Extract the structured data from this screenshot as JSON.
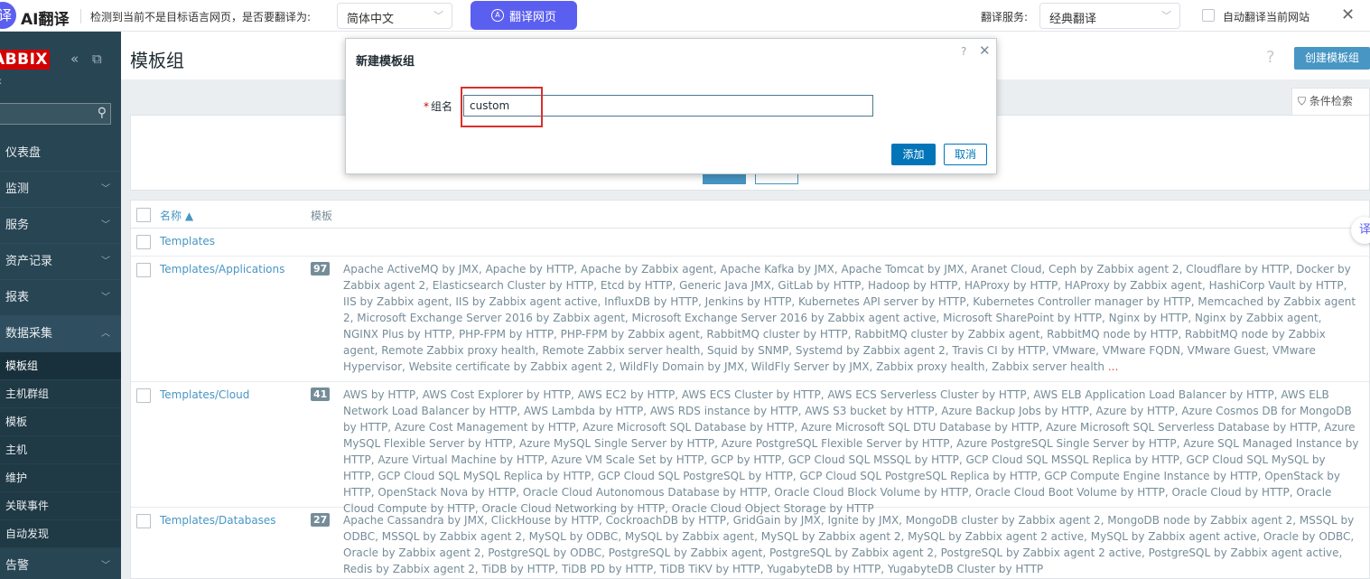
{
  "translate_bar": {
    "logo_glyph": "译",
    "brand": "AI翻译",
    "prompt": "检测到当前不是目标语言网页，是否要翻译为:",
    "target_language": "简体中文",
    "translate_button": "翻译网页",
    "service_label": "翻译服务:",
    "service_value": "经典翻译",
    "auto_label": "自动翻译当前网站",
    "close_glyph": "✕"
  },
  "sidebar": {
    "logo": "ABBIX",
    "subtitle": "x",
    "menu": [
      {
        "label": "仪表盘",
        "has_arrow": false
      },
      {
        "label": "监测",
        "has_arrow": true
      },
      {
        "label": "服务",
        "has_arrow": true
      },
      {
        "label": "资产记录",
        "has_arrow": true
      },
      {
        "label": "报表",
        "has_arrow": true
      }
    ],
    "open_menu": {
      "label": "数据采集"
    },
    "submenu": [
      "模板组",
      "主机群组",
      "模板",
      "主机",
      "维护",
      "关联事件",
      "自动发现"
    ],
    "after_menu": {
      "label": "告警"
    }
  },
  "header": {
    "title": "模板组",
    "help": "?",
    "create_button": "创建模板组"
  },
  "filter": {
    "tab_label": "条件检索"
  },
  "table": {
    "col_name": "名称 ▲",
    "col_templates": "模板",
    "rows": [
      {
        "name": "Templates",
        "count": "",
        "list": ""
      },
      {
        "name": "Templates/Applications",
        "count": "97",
        "list": "Apache ActiveMQ by JMX, Apache by HTTP, Apache by Zabbix agent, Apache Kafka by JMX, Apache Tomcat by JMX, Aranet Cloud, Ceph by Zabbix agent 2, Cloudflare by HTTP, Docker by Zabbix agent 2, Elasticsearch Cluster by HTTP, Etcd by HTTP, Generic Java JMX, GitLab by HTTP, Hadoop by HTTP, HAProxy by HTTP, HAProxy by Zabbix agent, HashiCorp Vault by HTTP, IIS by Zabbix agent, IIS by Zabbix agent active, InfluxDB by HTTP, Jenkins by HTTP, Kubernetes API server by HTTP, Kubernetes Controller manager by HTTP, Memcached by Zabbix agent 2, Microsoft Exchange Server 2016 by Zabbix agent, Microsoft Exchange Server 2016 by Zabbix agent active, Microsoft SharePoint by HTTP, Nginx by HTTP, Nginx by Zabbix agent, NGINX Plus by HTTP, PHP-FPM by HTTP, PHP-FPM by Zabbix agent, RabbitMQ cluster by HTTP, RabbitMQ cluster by Zabbix agent, RabbitMQ node by HTTP, RabbitMQ node by Zabbix agent, Remote Zabbix proxy health, Remote Zabbix server health, Squid by SNMP, Systemd by Zabbix agent 2, Travis CI by HTTP, VMware, VMware FQDN, VMware Guest, VMware Hypervisor, Website certificate by Zabbix agent 2, WildFly Domain by JMX, WildFly Server by JMX, Zabbix proxy health, Zabbix server health",
        "ellipsis": "..."
      },
      {
        "name": "Templates/Cloud",
        "count": "41",
        "list": "AWS by HTTP, AWS Cost Explorer by HTTP, AWS EC2 by HTTP, AWS ECS Cluster by HTTP, AWS ECS Serverless Cluster by HTTP, AWS ELB Application Load Balancer by HTTP, AWS ELB Network Load Balancer by HTTP, AWS Lambda by HTTP, AWS RDS instance by HTTP, AWS S3 bucket by HTTP, Azure Backup Jobs by HTTP, Azure by HTTP, Azure Cosmos DB for MongoDB by HTTP, Azure Cost Management by HTTP, Azure Microsoft SQL Database by HTTP, Azure Microsoft SQL DTU Database by HTTP, Azure Microsoft SQL Serverless Database by HTTP, Azure MySQL Flexible Server by HTTP, Azure MySQL Single Server by HTTP, Azure PostgreSQL Flexible Server by HTTP, Azure PostgreSQL Single Server by HTTP, Azure SQL Managed Instance by HTTP, Azure Virtual Machine by HTTP, Azure VM Scale Set by HTTP, GCP by HTTP, GCP Cloud SQL MSSQL by HTTP, GCP Cloud SQL MSSQL Replica by HTTP, GCP Cloud SQL MySQL by HTTP, GCP Cloud SQL MySQL Replica by HTTP, GCP Cloud SQL PostgreSQL by HTTP, GCP Cloud SQL PostgreSQL Replica by HTTP, GCP Compute Engine Instance by HTTP, OpenStack by HTTP, OpenStack Nova by HTTP, Oracle Cloud Autonomous Database by HTTP, Oracle Cloud Block Volume by HTTP, Oracle Cloud Boot Volume by HTTP, Oracle Cloud by HTTP, Oracle Cloud Compute by HTTP, Oracle Cloud Networking by HTTP, Oracle Cloud Object Storage by HTTP",
        "ellipsis": ""
      },
      {
        "name": "Templates/Databases",
        "count": "27",
        "list": "Apache Cassandra by JMX, ClickHouse by HTTP, CockroachDB by HTTP, GridGain by JMX, Ignite by JMX, MongoDB cluster by Zabbix agent 2, MongoDB node by Zabbix agent 2, MSSQL by ODBC, MSSQL by Zabbix agent 2, MySQL by ODBC, MySQL by Zabbix agent, MySQL by Zabbix agent 2, MySQL by Zabbix agent 2 active, MySQL by Zabbix agent active, Oracle by ODBC, Oracle by Zabbix agent 2, PostgreSQL by ODBC, PostgreSQL by Zabbix agent, PostgreSQL by Zabbix agent 2, PostgreSQL by Zabbix agent 2 active, PostgreSQL by Zabbix agent active, Redis by Zabbix agent 2, TiDB by HTTP, TiDB PD by HTTP, TiDB TiKV by HTTP, YugabyteDB by HTTP, YugabyteDB Cluster by HTTP",
        "ellipsis": ""
      }
    ]
  },
  "modal": {
    "title": "新建模板组",
    "help": "?",
    "close": "✕",
    "required_mark": "*",
    "field_label": "组名",
    "field_value": "custom",
    "add_button": "添加",
    "cancel_button": "取消"
  },
  "float_button": {
    "glyph": "译"
  },
  "colors": {
    "translate_accent": "#5b5ff0",
    "sidebar_bg": "#284554",
    "zabbix_red": "#d40000",
    "link_blue": "#4796c4",
    "primary_button": "#0275b8",
    "highlight_box": "#d9312b"
  }
}
